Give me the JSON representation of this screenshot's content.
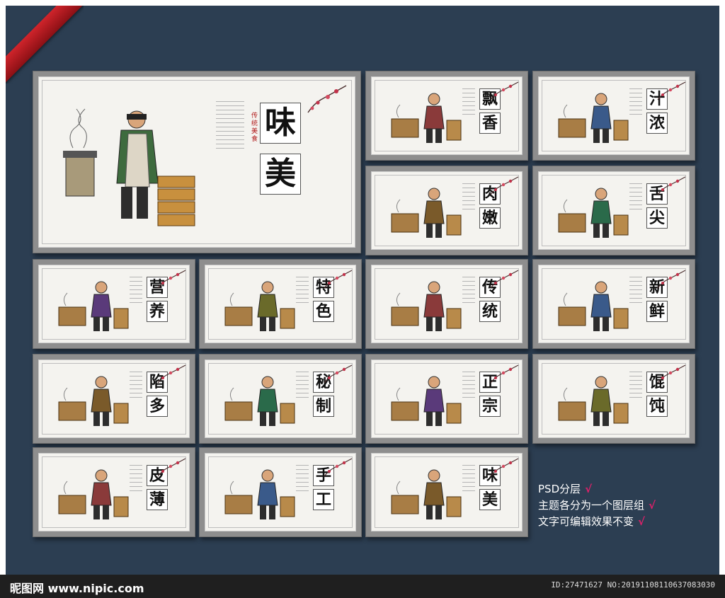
{
  "footer": {
    "logo": "昵图网 www.nipic.com",
    "id": "ID:27471627 NO:20191108110637083030"
  },
  "main_panel": {
    "title": [
      "味",
      "美"
    ],
    "seal": "传统美食"
  },
  "panels": [
    {
      "title": [
        "飘",
        "香"
      ]
    },
    {
      "title": [
        "汁",
        "浓"
      ]
    },
    {
      "title": [
        "肉",
        "嫩"
      ]
    },
    {
      "title": [
        "舌",
        "尖"
      ]
    },
    {
      "title": [
        "营",
        "养"
      ]
    },
    {
      "title": [
        "特",
        "色"
      ]
    },
    {
      "title": [
        "传",
        "统"
      ]
    },
    {
      "title": [
        "新",
        "鲜"
      ]
    },
    {
      "title": [
        "陷",
        "多"
      ]
    },
    {
      "title": [
        "秘",
        "制"
      ]
    },
    {
      "title": [
        "正",
        "宗"
      ]
    },
    {
      "title": [
        "馄",
        "饨"
      ]
    },
    {
      "title": [
        "皮",
        "薄"
      ]
    },
    {
      "title": [
        "手",
        "工"
      ]
    },
    {
      "title": [
        "味",
        "美"
      ]
    }
  ],
  "notes": [
    "PSD分层",
    "主题各分为一个图层组",
    "文字可编辑效果不变"
  ],
  "check_mark": "√"
}
